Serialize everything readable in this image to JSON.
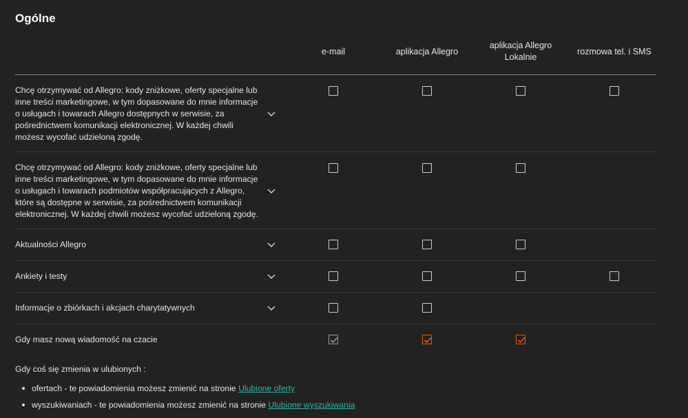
{
  "section_title": "Ogólne",
  "columns": [
    {
      "label": "e-mail"
    },
    {
      "label": "aplikacja Allegro"
    },
    {
      "label": "aplikacja Allegro Lokalnie"
    },
    {
      "label": "rozmowa tel. i SMS"
    }
  ],
  "rows": [
    {
      "label": "Chcę otrzymywać od Allegro: kody zniżkowe, oferty specjalne lub inne treści marketingowe, w tym dopasowane do mnie informacje o usługach i towarach Allegro dostępnych w serwisie, za pośrednictwem komunikacji elektronicznej. W każdej chwili możesz wycofać udzieloną zgodę.",
      "checkboxes": [
        "unchecked",
        "unchecked",
        "unchecked",
        "unchecked"
      ]
    },
    {
      "label": "Chcę otrzymywać od Allegro: kody zniżkowe, oferty specjalne lub inne treści marketingowe, w tym dopasowane do mnie informacje o usługach i towarach podmiotów współpracujących z Allegro, które są dostępne w serwisie, za pośrednictwem komunikacji elektronicznej. W każdej chwili możesz wycofać udzieloną zgodę.",
      "checkboxes": [
        "unchecked",
        "unchecked",
        "unchecked",
        null
      ]
    },
    {
      "label": "Aktualności Allegro",
      "checkboxes": [
        "unchecked",
        "unchecked",
        "unchecked",
        null
      ]
    },
    {
      "label": "Ankiety i testy",
      "checkboxes": [
        "unchecked",
        "unchecked",
        "unchecked",
        "unchecked"
      ]
    },
    {
      "label": "Informacje o zbiórkach i akcjach charytatywnych",
      "checkboxes": [
        "unchecked",
        "unchecked",
        null,
        null
      ]
    },
    {
      "label": "Gdy masz nową wiadomość na czacie",
      "checkboxes": [
        "checked-disabled",
        "checked",
        "checked",
        null
      ]
    }
  ],
  "footer": {
    "intro": "Gdy coś się zmienia w ulubionych :",
    "bullets": [
      {
        "text": "ofertach - te powiadomienia możesz zmienić na stronie ",
        "link": "Ulubione oferty"
      },
      {
        "text": "wyszukiwaniach - te powiadomienia możesz zmienić na stronie ",
        "link": "Ulubione wyszukiwania"
      }
    ]
  },
  "colors": {
    "background": "#222222",
    "accent_orange": "#ff5a00",
    "link_teal": "#2bb5a6",
    "divider": "#3a3a3a"
  },
  "icons": {
    "row_expand": "chevron-down-icon",
    "checkmark": "checkmark-icon"
  }
}
